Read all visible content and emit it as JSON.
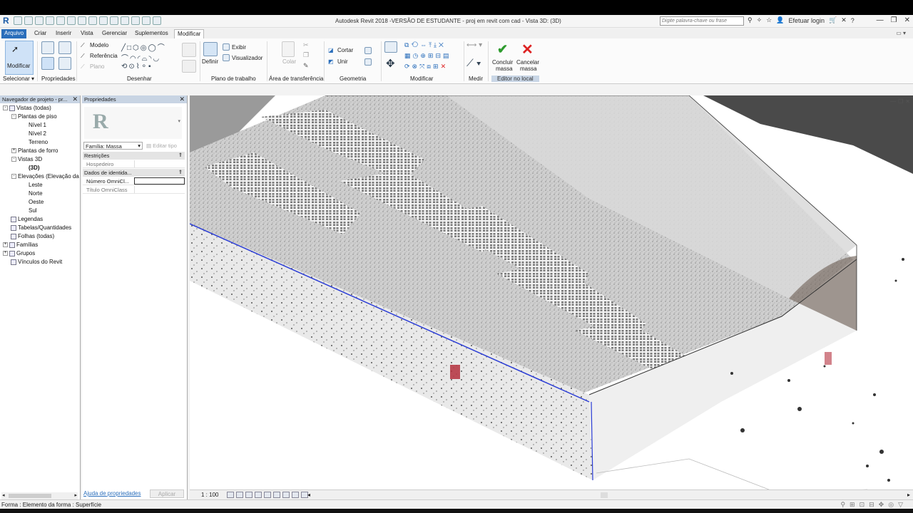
{
  "app": {
    "title": "Autodesk Revit 2018 -VERSÃO DE ESTUDANTE -    proj em revit com cad - Vista 3D: (3D)",
    "logo": "R",
    "search_placeholder": "Digite palavra-chave ou frase",
    "login_label": "Efetuar login"
  },
  "menu": {
    "tabs": [
      "Arquivo",
      "Criar",
      "Inserir",
      "Vista",
      "Gerenciar",
      "Suplementos",
      "Modificar"
    ],
    "active": "Modificar"
  },
  "ribbon": {
    "modify_label": "Modificar",
    "select_label": "Selecionar",
    "properties_label": "Propriedades",
    "draw_items": [
      "Modelo",
      "Referência",
      "Plano"
    ],
    "draw_label": "Desenhar",
    "define_label": "Definir",
    "show_label": "Exibir",
    "viewer_label": "Visualizador",
    "workplane_label": "Plano de trabalho",
    "paste_label": "Colar",
    "clipboard_label": "Área de transferência",
    "cut_label": "Cortar",
    "join_label": "Unir",
    "geometry_label": "Geometria",
    "modify_panel_label": "Modificar",
    "measure_label": "Medir",
    "finish_mass_label": "Concluir massa",
    "cancel_mass_label": "Cancelar massa",
    "inplace_editor_label": "Editor no local",
    "finish_line1": "Concluir",
    "finish_line2": "massa",
    "cancel_line1": "Cancelar",
    "cancel_line2": "massa"
  },
  "browser": {
    "title": "Navegador de projeto - pr...",
    "nodes": [
      {
        "label": "Vistas (todas)",
        "level": 0,
        "toggle": "-",
        "icon": true
      },
      {
        "label": "Plantas de piso",
        "level": 1,
        "toggle": "-"
      },
      {
        "label": "Nível 1",
        "level": 2
      },
      {
        "label": "Nível 2",
        "level": 2
      },
      {
        "label": "Terreno",
        "level": 2
      },
      {
        "label": "Plantas de forro",
        "level": 1,
        "toggle": "+"
      },
      {
        "label": "Vistas 3D",
        "level": 1,
        "toggle": "-"
      },
      {
        "label": "(3D)",
        "level": 2,
        "bold": true
      },
      {
        "label": "Elevações (Elevação da",
        "level": 1,
        "toggle": "-"
      },
      {
        "label": "Leste",
        "level": 2
      },
      {
        "label": "Norte",
        "level": 2
      },
      {
        "label": "Oeste",
        "level": 2
      },
      {
        "label": "Sul",
        "level": 2
      },
      {
        "label": "Legendas",
        "level": 0,
        "icon": true
      },
      {
        "label": "Tabelas/Quantidades",
        "level": 0,
        "icon": true
      },
      {
        "label": "Folhas (todas)",
        "level": 0,
        "icon": true
      },
      {
        "label": "Famílias",
        "level": 0,
        "toggle": "+",
        "icon": true
      },
      {
        "label": "Grupos",
        "level": 0,
        "toggle": "+",
        "icon": true
      },
      {
        "label": "Vínculos do Revit",
        "level": 0,
        "icon": true
      }
    ]
  },
  "properties": {
    "title": "Propriedades",
    "type_logo": "R",
    "family_select": "Família: Massa",
    "edit_type": "Editar tipo",
    "sections": [
      {
        "name": "Restrições",
        "rows": [
          {
            "key": "Hospedeiro",
            "value": ""
          }
        ]
      },
      {
        "name": "Dados de identida...",
        "rows": [
          {
            "key": "Número OmniCl...",
            "value": ""
          },
          {
            "key": "Título OmniClass",
            "value": ""
          }
        ]
      }
    ],
    "help_link": "Ajuda de propriedades",
    "apply_label": "Aplicar"
  },
  "viewbar": {
    "scale": "1 : 100"
  },
  "status": {
    "text": "Forma : Elemento da forma : Superfície"
  },
  "colors": {
    "accent": "#2a6ebb",
    "panel_header": "#c8d4e3",
    "selection_edge": "#2b3dd6"
  }
}
